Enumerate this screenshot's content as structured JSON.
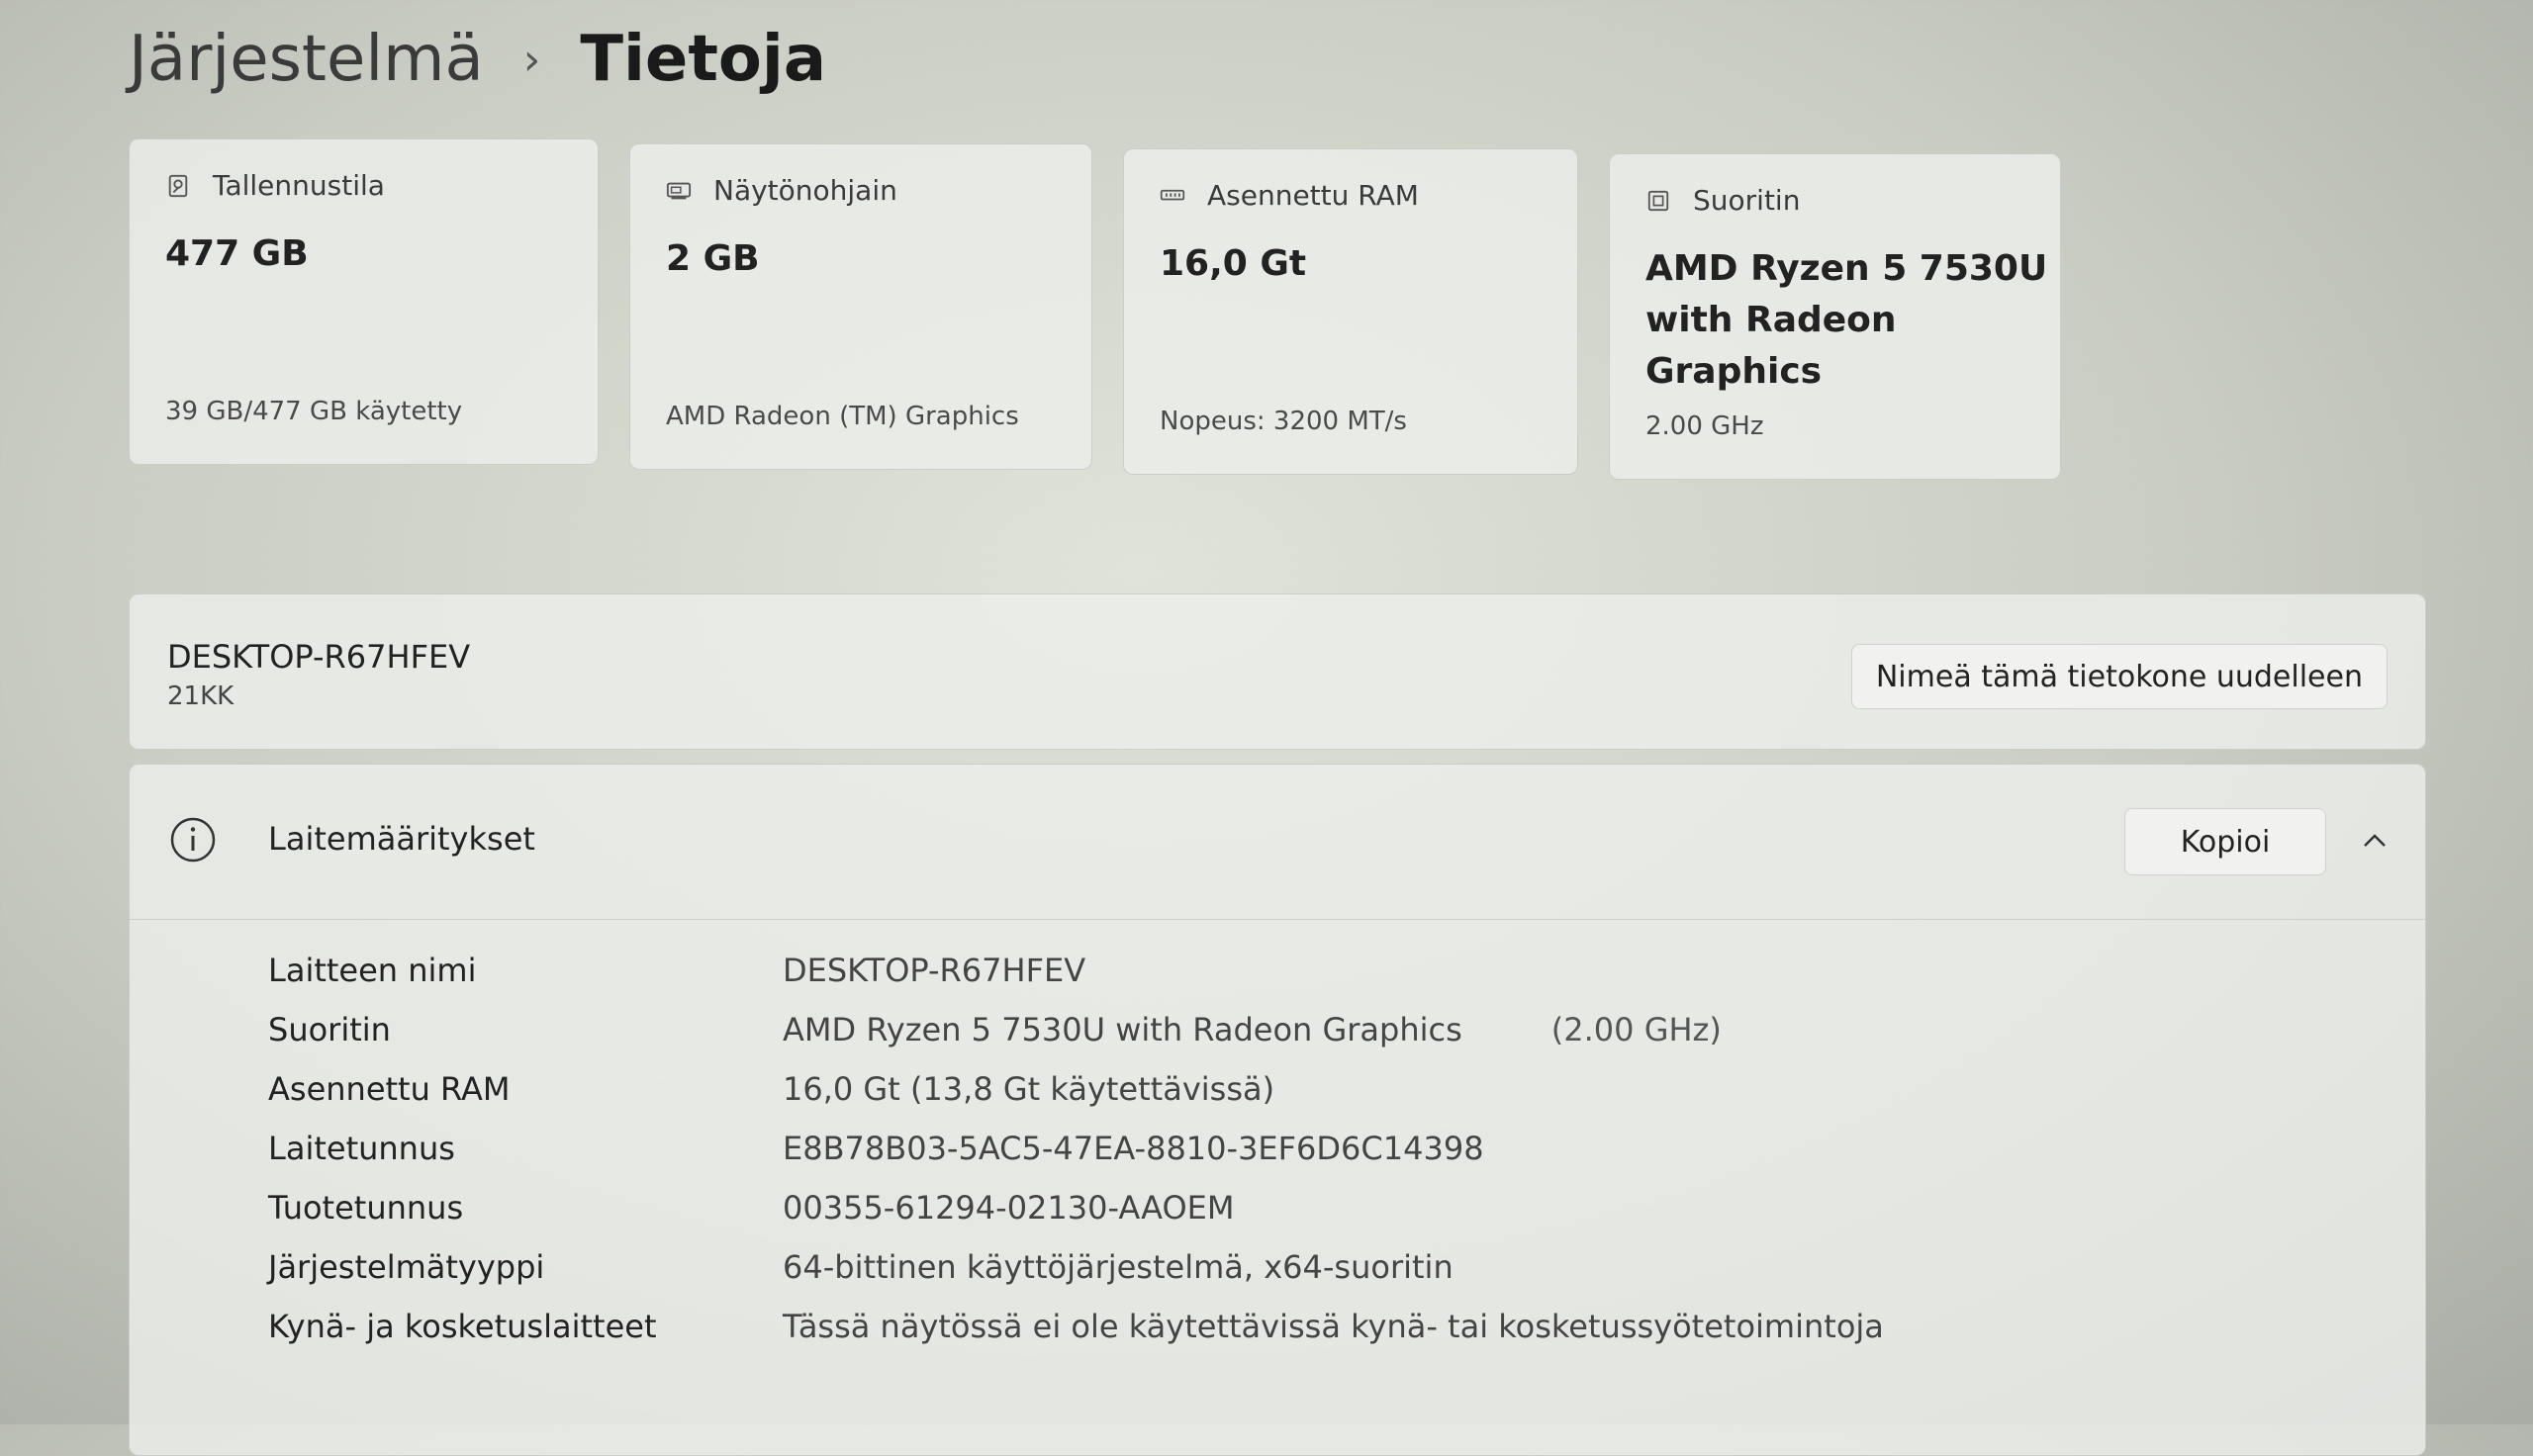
{
  "breadcrumb": {
    "parent": "Järjestelmä",
    "separator": "›",
    "current": "Tietoja"
  },
  "cards": [
    {
      "icon": "storage-icon",
      "label": "Tallennustila",
      "value": "477 GB",
      "sub": "39 GB/477 GB käytetty"
    },
    {
      "icon": "gpu-icon",
      "label": "Näytönohjain",
      "value": "2 GB",
      "sub": "AMD Radeon (TM) Graphics"
    },
    {
      "icon": "ram-icon",
      "label": "Asennettu RAM",
      "value": "16,0 Gt",
      "sub": "Nopeus: 3200 MT/s"
    },
    {
      "icon": "cpu-icon",
      "label": "Suoritin",
      "value_line1": "AMD Ryzen 5 7530U",
      "value_line2": "with Radeon Graphics",
      "sub": "2.00 GHz"
    }
  ],
  "device": {
    "name": "DESKTOP-R67HFEV",
    "model": "21KK",
    "rename_label": "Nimeä tämä tietokone uudelleen"
  },
  "specs": {
    "title": "Laitemääritykset",
    "copy_label": "Kopioi",
    "rows": [
      {
        "label": "Laitteen nimi",
        "value": "DESKTOP-R67HFEV"
      },
      {
        "label": "Suoritin",
        "value": "AMD Ryzen 5 7530U with Radeon Graphics",
        "extra": "(2.00 GHz)"
      },
      {
        "label": "Asennettu RAM",
        "value": "16,0 Gt (13,8 Gt käytettävissä)"
      },
      {
        "label": "Laitetunnus",
        "value": "E8B78B03-5AC5-47EA-8810-3EF6D6C14398"
      },
      {
        "label": "Tuotetunnus",
        "value": "00355-61294-02130-AAOEM"
      },
      {
        "label": "Järjestelmätyyppi",
        "value": "64-bittinen käyttöjärjestelmä, x64-suoritin"
      },
      {
        "label": "Kynä- ja kosketuslaitteet",
        "value": "Tässä näytössä ei ole käytettävissä kynä- tai kosketussyötetoimintoja"
      }
    ]
  }
}
